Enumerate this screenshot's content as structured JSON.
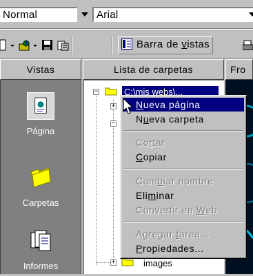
{
  "formatting_toolbar": {
    "style_value": "Normal",
    "font_value": "Arial"
  },
  "standard_toolbar": {
    "views_bar_label_before": "Barra de ",
    "views_bar_label_u": "v",
    "views_bar_label_after": "istas"
  },
  "views_pane": {
    "header": "Vistas",
    "items": [
      {
        "label": "Página",
        "icon": "page-view-icon"
      },
      {
        "label": "Carpetas",
        "icon": "folder-view-icon"
      },
      {
        "label": "Informes",
        "icon": "reports-view-icon"
      }
    ]
  },
  "folder_list": {
    "header": "Lista de carpetas",
    "root_label": "C:\\mis webs\\...",
    "child_label": "images"
  },
  "front_pane": {
    "header": "Fro"
  },
  "context_menu": {
    "items": [
      {
        "pre": "",
        "u": "N",
        "post": "ueva página",
        "state": "selected"
      },
      {
        "pre": "N",
        "u": "u",
        "post": "eva carpeta",
        "state": "enabled"
      },
      {
        "pre": "Co",
        "u": "r",
        "post": "tar",
        "state": "disabled"
      },
      {
        "pre": "",
        "u": "C",
        "post": "opiar",
        "state": "enabled"
      },
      {
        "pre": "Cam",
        "u": "b",
        "post": "iar nombre",
        "state": "disabled"
      },
      {
        "pre": "Eli",
        "u": "m",
        "post": "inar",
        "state": "enabled"
      },
      {
        "pre": "Convertir en ",
        "u": "W",
        "post": "eb",
        "state": "disabled"
      },
      {
        "pre": "Agregar ",
        "u": "t",
        "post": "area...",
        "state": "disabled"
      },
      {
        "pre": "",
        "u": "P",
        "post": "ropiedades...",
        "state": "enabled"
      }
    ]
  },
  "colors": {
    "face": "#c0c0c0",
    "highlight": "#000080",
    "views_background": "#808080",
    "folder_yellow": "#ffff00"
  }
}
